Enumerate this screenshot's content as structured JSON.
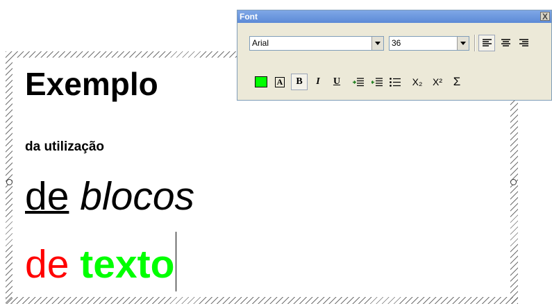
{
  "toolbar": {
    "title": "Font",
    "close_label": "X",
    "font_name": "Arial",
    "font_size": "36",
    "align_left_glyph": "≡",
    "align_center_glyph": "≡",
    "align_right_glyph": "≡",
    "color_swatch": "#00ff00",
    "highlight_glyph": "A",
    "bold_glyph": "B",
    "italic_glyph": "I",
    "underline_glyph": "U",
    "decrease_indent_glyph": "⇤",
    "increase_indent_glyph": "⇥",
    "bullets_glyph": "☰",
    "subscript_glyph": "X₂",
    "superscript_glyph": "X²",
    "sum_glyph": "Σ"
  },
  "textbox": {
    "line1": "Exemplo",
    "line2_prefix": "da ",
    "line2_rest": "utilização",
    "line3_underlined": "de",
    "line3_italic": "blocos",
    "line4_red": "de",
    "line4_green": "texto"
  },
  "colors": {
    "red": "#ff0000",
    "green": "#00ff00"
  }
}
